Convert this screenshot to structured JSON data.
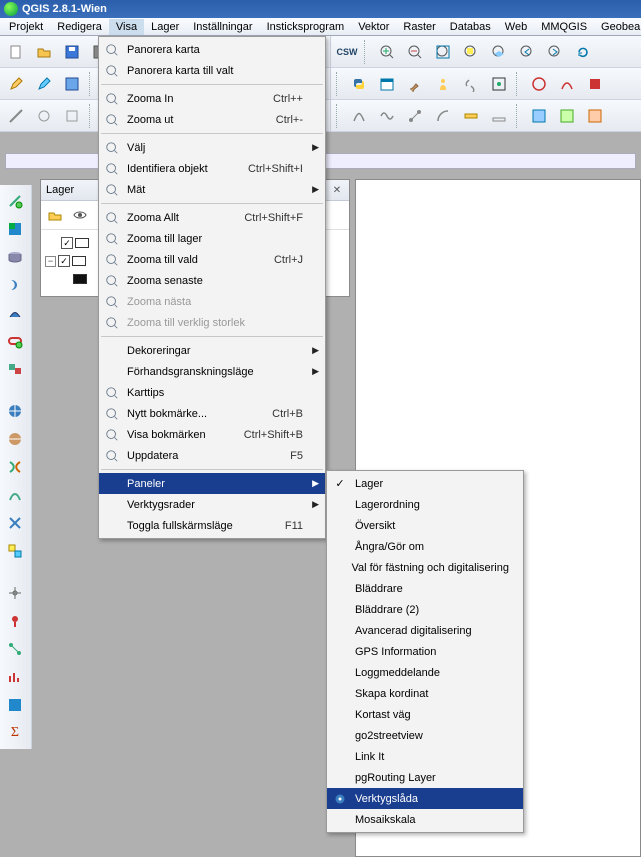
{
  "app": {
    "title": "QGIS 2.8.1-Wien"
  },
  "menubar": {
    "items": [
      "Projekt",
      "Redigera",
      "Visa",
      "Lager",
      "Inställningar",
      "Insticksprogram",
      "Vektor",
      "Raster",
      "Databas",
      "Web",
      "MMQGIS",
      "Geobearbetning"
    ],
    "open_index": 2
  },
  "layers_panel": {
    "title": "Lager"
  },
  "visa_menu": {
    "items": [
      {
        "icon": "pan-icon",
        "label": "Panorera karta",
        "shortcut": ""
      },
      {
        "icon": "pan-to-sel-icon",
        "label": "Panorera karta till valt",
        "shortcut": ""
      },
      {
        "sep": true
      },
      {
        "icon": "zoom-in-icon",
        "label": "Zooma In",
        "shortcut": "Ctrl++"
      },
      {
        "icon": "zoom-out-icon",
        "label": "Zooma ut",
        "shortcut": "Ctrl+-"
      },
      {
        "sep": true
      },
      {
        "icon": "select-icon",
        "label": "Välj",
        "submenu": true
      },
      {
        "icon": "identify-icon",
        "label": "Identifiera objekt",
        "shortcut": "Ctrl+Shift+I"
      },
      {
        "icon": "measure-icon",
        "label": "Mät",
        "submenu": true
      },
      {
        "sep": true
      },
      {
        "icon": "zoom-full-icon",
        "label": "Zooma Allt",
        "shortcut": "Ctrl+Shift+F"
      },
      {
        "icon": "zoom-layer-icon",
        "label": "Zooma till lager",
        "shortcut": ""
      },
      {
        "icon": "zoom-sel-icon",
        "label": "Zooma till vald",
        "shortcut": "Ctrl+J"
      },
      {
        "icon": "zoom-last-icon",
        "label": "Zooma senaste",
        "shortcut": ""
      },
      {
        "icon": "zoom-next-icon",
        "label": "Zooma nästa",
        "shortcut": "",
        "disabled": true
      },
      {
        "icon": "zoom-native-icon",
        "label": "Zooma till verklig storlek",
        "shortcut": "",
        "disabled": true
      },
      {
        "sep": true
      },
      {
        "icon": "",
        "label": "Dekoreringar",
        "submenu": true
      },
      {
        "icon": "",
        "label": "Förhandsgranskningsläge",
        "submenu": true
      },
      {
        "icon": "tips-icon",
        "label": "Karttips",
        "shortcut": ""
      },
      {
        "icon": "bookmark-new-icon",
        "label": "Nytt bokmärke...",
        "shortcut": "Ctrl+B"
      },
      {
        "icon": "bookmark-show-icon",
        "label": "Visa bokmärken",
        "shortcut": "Ctrl+Shift+B"
      },
      {
        "icon": "refresh-icon",
        "label": "Uppdatera",
        "shortcut": "F5"
      },
      {
        "sep": true
      },
      {
        "icon": "",
        "label": "Paneler",
        "submenu": true,
        "highlight": true
      },
      {
        "icon": "",
        "label": "Verktygsrader",
        "submenu": true
      },
      {
        "icon": "",
        "label": "Toggla fullskärmsläge",
        "shortcut": "F11"
      }
    ]
  },
  "paneler_submenu": {
    "items": [
      {
        "checked": true,
        "label": "Lager"
      },
      {
        "checked": false,
        "label": "Lagerordning"
      },
      {
        "checked": false,
        "label": "Översikt"
      },
      {
        "checked": false,
        "label": "Ångra/Gör om"
      },
      {
        "checked": false,
        "label": "Val för fästning och digitalisering"
      },
      {
        "checked": false,
        "label": "Bläddrare"
      },
      {
        "checked": false,
        "label": "Bläddrare (2)"
      },
      {
        "checked": false,
        "label": "Avancerad digitalisering"
      },
      {
        "checked": false,
        "label": "GPS Information"
      },
      {
        "checked": false,
        "label": "Loggmeddelande"
      },
      {
        "checked": false,
        "label": "Skapa kordinat"
      },
      {
        "checked": false,
        "label": "Kortast väg"
      },
      {
        "checked": false,
        "label": "go2streetview"
      },
      {
        "checked": false,
        "label": "Link It"
      },
      {
        "checked": false,
        "label": "pgRouting Layer"
      },
      {
        "checked": false,
        "label": "Verktygslåda",
        "icon": "gear-icon",
        "selected": true
      },
      {
        "checked": false,
        "label": "Mosaikskala"
      }
    ]
  }
}
